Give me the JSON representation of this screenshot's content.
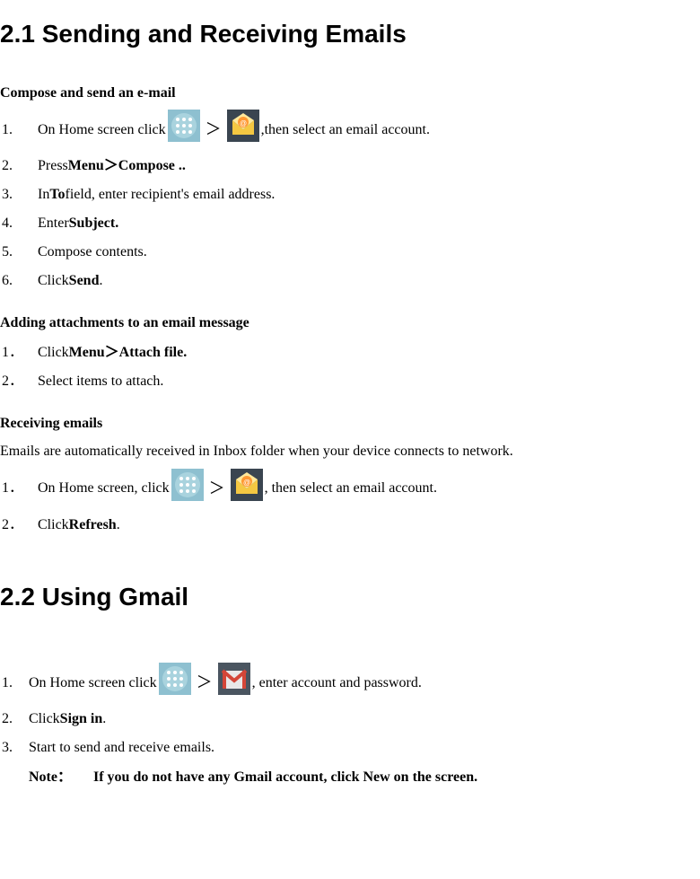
{
  "section21": {
    "title": "2.1 Sending and Receiving Emails",
    "compose": {
      "heading": "Compose and send an e-mail",
      "steps": [
        {
          "num": "1.",
          "pre": "On Home screen click",
          "post": " ,then select an email account."
        },
        {
          "num": "2.",
          "text_pre": "Press ",
          "bold": "Menu＞Compose .."
        },
        {
          "num": "3.",
          "text_pre": "In ",
          "bold": "To",
          "text_post": " field, enter recipient's email address."
        },
        {
          "num": "4.",
          "text_pre": "Enter ",
          "bold": "Subject."
        },
        {
          "num": "5.",
          "text": "Compose contents."
        },
        {
          "num": "6.",
          "text_pre": "Click ",
          "bold": "Send",
          "text_post": "."
        }
      ]
    },
    "attachments": {
      "heading": "Adding attachments to an email message",
      "steps": [
        {
          "num": "1．",
          "text_pre": "Click ",
          "bold": "Menu＞Attach file."
        },
        {
          "num": "2．",
          "text": "Select items to attach."
        }
      ]
    },
    "receiving": {
      "heading": "Receiving emails",
      "desc": "Emails are automatically received in Inbox folder when your device connects to network.",
      "steps": [
        {
          "num": "1．",
          "pre": "On Home screen, click ",
          "post": ", then select an email account."
        },
        {
          "num": "2．",
          "text_pre": "Click ",
          "bold": "Refresh",
          "text_post": "."
        }
      ]
    }
  },
  "section22": {
    "title": "2.2 Using Gmail",
    "steps": [
      {
        "num": "1.",
        "pre": "On Home screen click",
        "post": ", enter account and password."
      },
      {
        "num": "2.",
        "text_pre": "Click ",
        "bold": "Sign in",
        "text_post": "."
      },
      {
        "num": "3.",
        "text": "Start to send and receive emails."
      }
    ],
    "note_label": "Note：",
    "note_text": "If you do not have any Gmail account, click New on the screen."
  },
  "arrow": "＞"
}
